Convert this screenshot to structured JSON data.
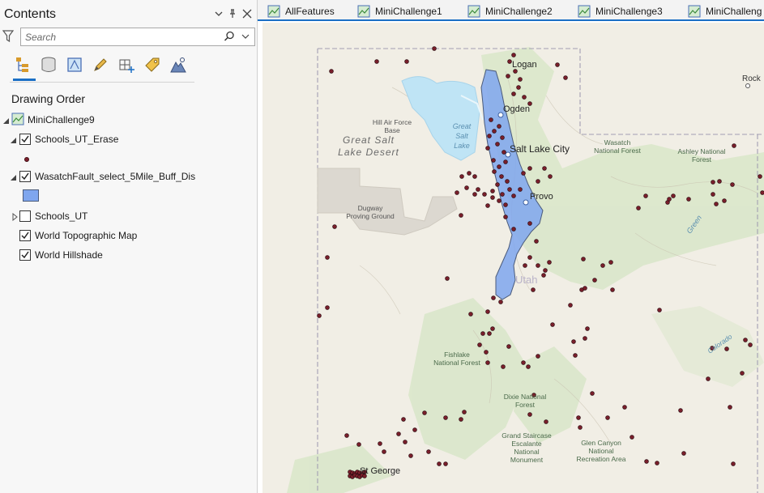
{
  "contents_pane": {
    "title": "Contents",
    "search_placeholder": "Search",
    "drawing_order_label": "Drawing Order",
    "map_name": "MiniChallenge9",
    "layers": [
      {
        "name": "Schools_UT_Erase",
        "checked": true,
        "expanded": true
      },
      {
        "name": "WasatchFault_select_5Mile_Buff_Dis",
        "checked": true,
        "expanded": true
      },
      {
        "name": "Schools_UT",
        "checked": false,
        "expanded": false
      },
      {
        "name": "World Topographic Map",
        "checked": true
      },
      {
        "name": "World Hillshade",
        "checked": true
      }
    ]
  },
  "tabs": [
    "AllFeatures",
    "MiniChallenge1",
    "MiniChallenge2",
    "MiniChallenge3",
    "MiniChalleng"
  ],
  "map_labels": {
    "logan": "Logan",
    "ogden": "Ogden",
    "slc": "Salt Lake City",
    "provo": "Provo",
    "hill_air_force_1": "Hill Air Force",
    "hill_air_force_2": "Base",
    "great_salt_lake_1": "Great",
    "great_salt_lake_2": "Salt",
    "great_salt_lake_3": "Lake",
    "gsl_desert_1": "Great Salt",
    "gsl_desert_2": "Lake Desert",
    "dugway_1": "Dugway",
    "dugway_2": "Proving Ground",
    "wasatch_nf_1": "Wasatch",
    "wasatch_nf_2": "National Forest",
    "ashley_nf_1": "Ashley National",
    "ashley_nf_2": "Forest",
    "utah": "Utah",
    "green": "Green",
    "colorado": "Colorado",
    "fishlake_1": "Fishlake",
    "fishlake_2": "National Forest",
    "dixie_1": "Dixie National",
    "dixie_2": "Forest",
    "gsenm_1": "Grand Staircase",
    "gsenm_2": "Escalante",
    "gsenm_3": "National",
    "gsenm_4": "Monument",
    "glen_1": "Glen Canyon",
    "glen_2": "National",
    "glen_3": "Recreation Area",
    "st_george": "St George",
    "rock": "Rock"
  },
  "colors": {
    "accent": "#1b6fc5",
    "buffer_fill": "#7fa6ee",
    "school_point": "#7a1f2b",
    "lake": "#bfe4f5"
  }
}
